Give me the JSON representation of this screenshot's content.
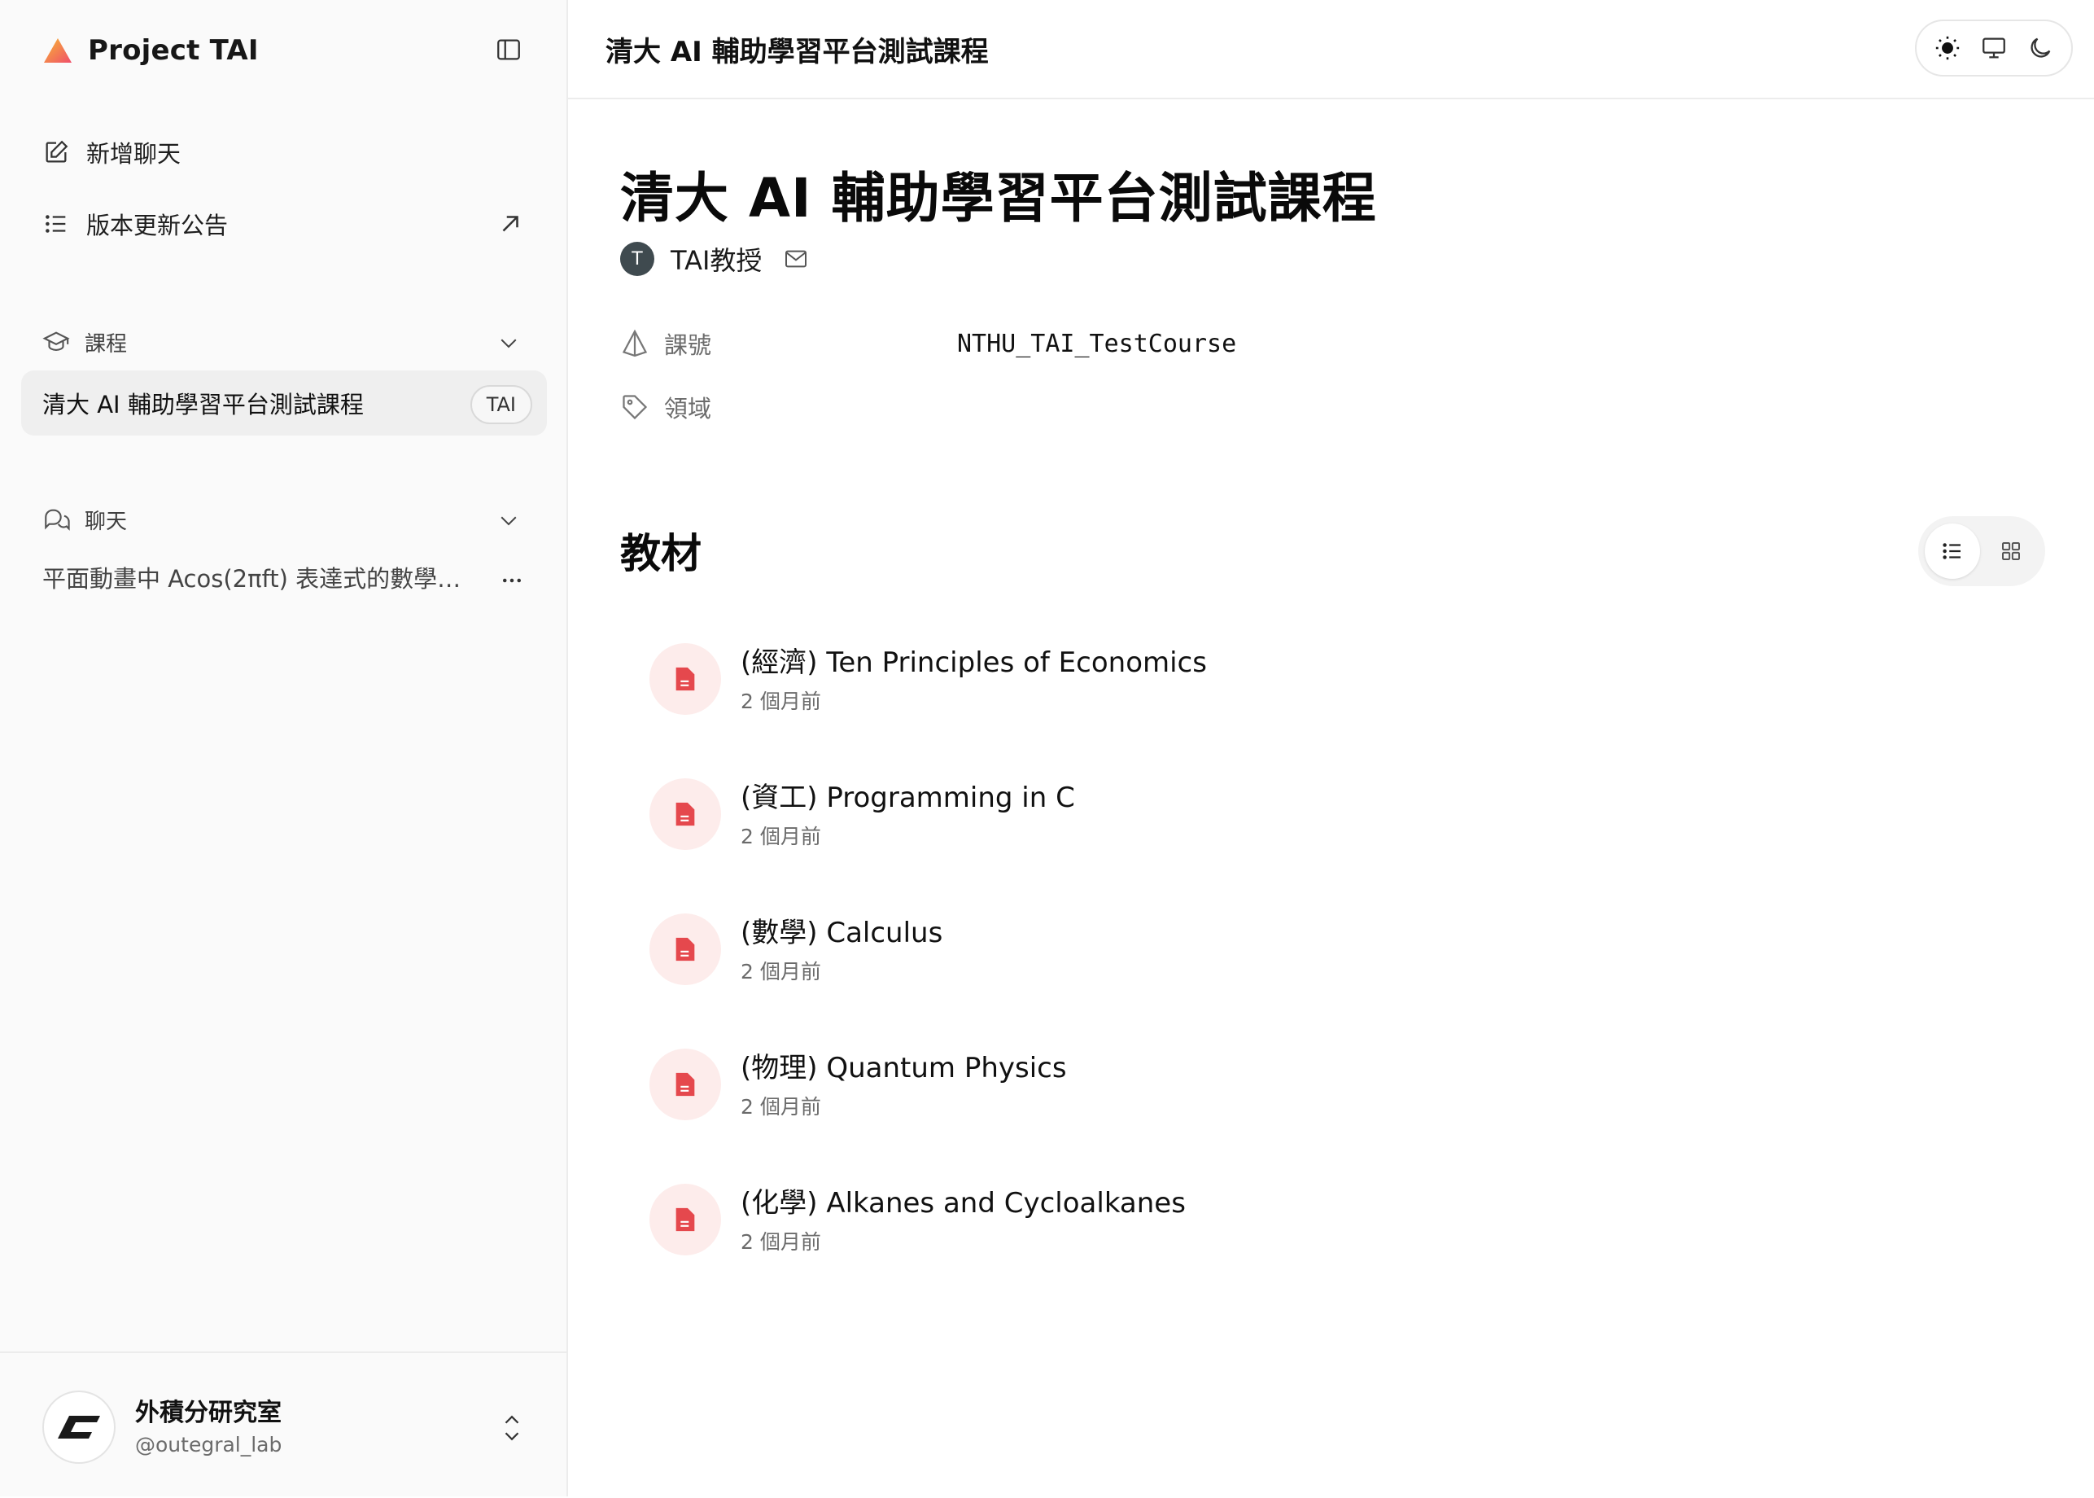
{
  "sidebar": {
    "brand": "Project TAI",
    "new_chat": "新增聊天",
    "changelog": "版本更新公告",
    "courses_label": "課程",
    "course_item": {
      "label": "清大 AI 輔助學習平台測試課程",
      "badge": "TAI"
    },
    "chats_label": "聊天",
    "chat_item": "平面動畫中 Acos(2πft) 表達式的數學…",
    "footer": {
      "org_name": "外積分研究室",
      "handle": "@outegral_lab"
    }
  },
  "topbar": {
    "title": "清大 AI 輔助學習平台測試課程"
  },
  "course": {
    "title": "清大 AI 輔助學習平台測試課程",
    "professor_initial": "T",
    "professor": "TAI教授",
    "meta": {
      "code_label": "課號",
      "code_value": "NTHU_TAI_TestCourse",
      "field_label": "領域"
    }
  },
  "materials": {
    "title": "教材",
    "items": [
      {
        "name": "(經濟) Ten Principles of Economics",
        "date": "2 個月前"
      },
      {
        "name": "(資工) Programming in C",
        "date": "2 個月前"
      },
      {
        "name": "(數學) Calculus",
        "date": "2 個月前"
      },
      {
        "name": "(物理) Quantum Physics",
        "date": "2 個月前"
      },
      {
        "name": "(化學) Alkanes and Cycloalkanes",
        "date": "2 個月前"
      }
    ]
  },
  "colors": {
    "accent_file": "#e5484d",
    "file_bg": "#fdeceb"
  }
}
